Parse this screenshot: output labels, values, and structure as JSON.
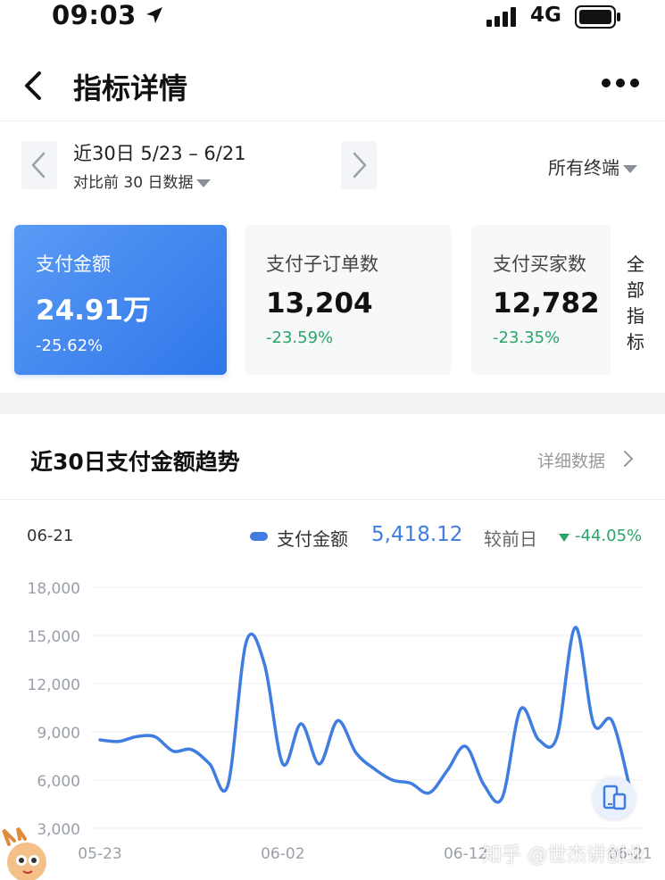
{
  "status_bar": {
    "time": "09:03",
    "network": "4G"
  },
  "nav": {
    "title": "指标详情"
  },
  "date_filter": {
    "range": "近30日 5/23 – 6/21",
    "compare": "对比前 30 日数据",
    "terminal": "所有终端"
  },
  "metrics": [
    {
      "label": "支付金额",
      "value": "24.91万",
      "change": "-25.62%"
    },
    {
      "label": "支付子订单数",
      "value": "13,204",
      "change": "-23.59%"
    },
    {
      "label": "支付买家数",
      "value": "12,782",
      "change": "-23.35%"
    }
  ],
  "all_metrics_label": "全部指标",
  "trend_section": {
    "title": "近30日支付金额趋势",
    "detail_link": "详细数据"
  },
  "tooltip": {
    "date": "06-21",
    "series_name": "支付金额",
    "value": "5,418.12",
    "compare_label": "较前日",
    "change": "-44.05%"
  },
  "watermark": "知乎 @世杰讲创业",
  "colors": {
    "accent": "#3f7de0",
    "positive_down": "#2aa56a"
  },
  "chart_data": {
    "type": "line",
    "x": [
      "05-23",
      "05-24",
      "05-25",
      "05-26",
      "05-27",
      "05-28",
      "05-29",
      "05-30",
      "05-31",
      "06-01",
      "06-02",
      "06-03",
      "06-04",
      "06-05",
      "06-06",
      "06-07",
      "06-08",
      "06-09",
      "06-10",
      "06-11",
      "06-12",
      "06-13",
      "06-14",
      "06-15",
      "06-16",
      "06-17",
      "06-18",
      "06-19",
      "06-20",
      "06-21"
    ],
    "series": [
      {
        "values": [
          8500,
          8400,
          8700,
          8700,
          7800,
          7900,
          7000,
          5700,
          14600,
          13200,
          7000,
          9500,
          7000,
          9700,
          7700,
          6700,
          6000,
          5800,
          5200,
          6600,
          8100,
          5700,
          4900,
          10400,
          8500,
          8700,
          15500,
          9500,
          9700,
          5418.12
        ]
      }
    ],
    "y_ticks": [
      "18,000",
      "15,000",
      "12,000",
      "9,000",
      "6,000",
      "3,000"
    ],
    "x_ticks": [
      "05-23",
      "06-02",
      "06-12",
      "06-21"
    ],
    "ylim": [
      3000,
      18000
    ],
    "grid": true
  }
}
